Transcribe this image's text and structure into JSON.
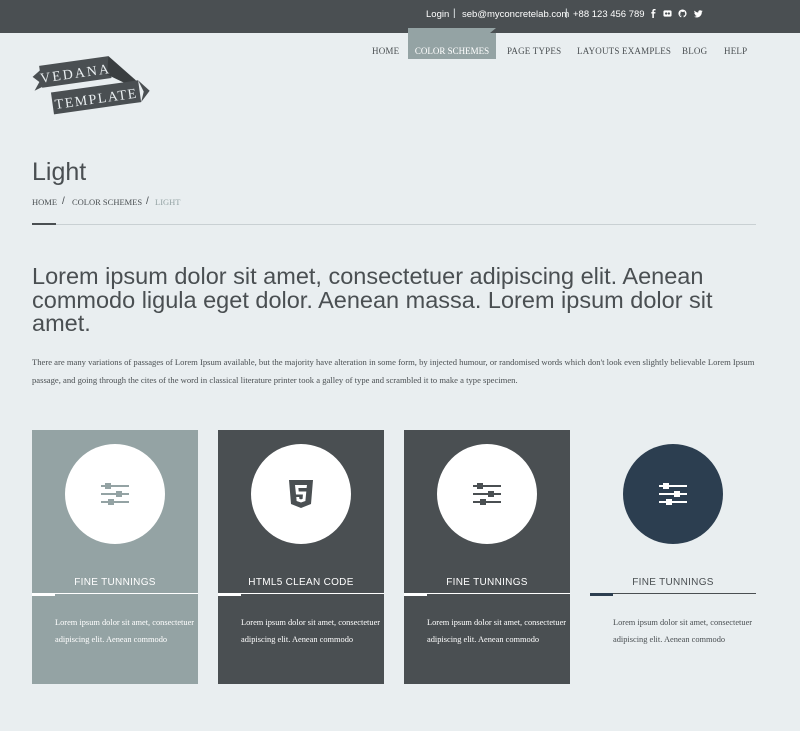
{
  "topbar": {
    "login": "Login",
    "email": "seb@myconcretelab.com",
    "phone": "+88 123 456 789",
    "separator": "|",
    "social_icons": [
      "facebook-icon",
      "flickr-icon",
      "github-icon",
      "twitter-icon"
    ]
  },
  "logo": {
    "line1": "VEDANA",
    "line2": "TEMPLATE"
  },
  "nav": {
    "home": "HOME",
    "color_schemes": "COLOR SCHEMES",
    "page_types": "PAGE TYPES",
    "layouts": "LAYOUTS EXAMPLES",
    "blog": "BLOG",
    "help": "HELP"
  },
  "page": {
    "title": "Light",
    "breadcrumb": [
      "HOME",
      "COLOR SCHEMES",
      "LIGHT"
    ],
    "breadcrumb_sep": "/"
  },
  "intro": {
    "lead": "Lorem ipsum dolor sit amet, consectetuer adipiscing elit. Aenean commodo ligula eget dolor. Aenean massa. Lorem ipsum dolor sit amet.",
    "body": "There are many variations of passages of Lorem Ipsum available, but the majority have alteration in some form, by injected humour, or randomised words which don't look even slightly believable Lorem Ipsum passage, and going through the cites of the word in classical literature printer took a galley of type and scrambled it to make a type specimen."
  },
  "cards": [
    {
      "title": "FINE TUNNINGS",
      "icon": "sliders-icon",
      "text": "Lorem ipsum dolor sit amet, consectetuer adipiscing elit. Aenean commodo"
    },
    {
      "title": "HTML5 CLEAN CODE",
      "icon": "html5-icon",
      "text": "Lorem ipsum dolor sit amet, consectetuer adipiscing elit. Aenean commodo"
    },
    {
      "title": "FINE TUNNINGS",
      "icon": "sliders-icon",
      "text": "Lorem ipsum dolor sit amet, consectetuer adipiscing elit. Aenean commodo"
    },
    {
      "title": "FINE TUNNINGS",
      "icon": "sliders-icon",
      "text": "Lorem ipsum dolor sit amet, consectetuer adipiscing elit. Aenean commodo"
    }
  ],
  "colors": {
    "background": "#e9eef0",
    "dark": "#4a4f52",
    "accent_gray": "#94a3a4",
    "navy": "#2c3e50"
  }
}
